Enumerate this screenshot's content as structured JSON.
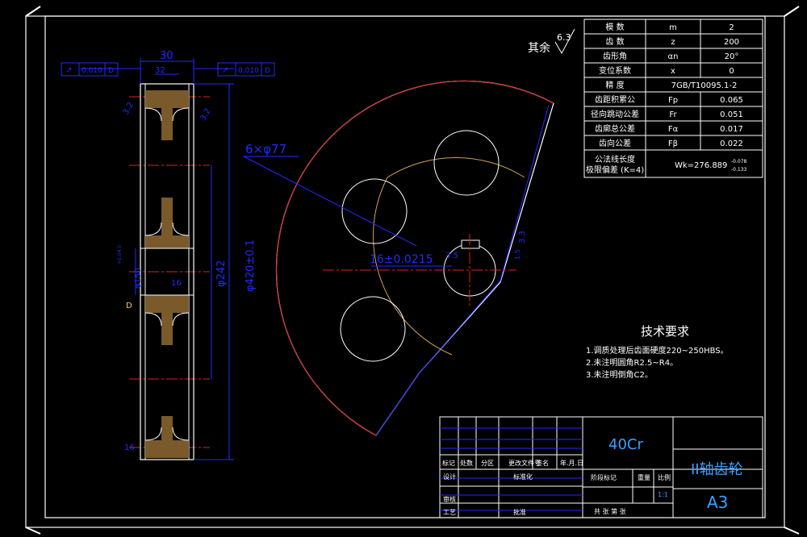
{
  "params": {
    "rows": [
      {
        "name": "模  数",
        "symbol": "m",
        "value": "2"
      },
      {
        "name": "齿  数",
        "symbol": "z",
        "value": "200"
      },
      {
        "name": "齿形角",
        "symbol": "αn",
        "value": "20°"
      },
      {
        "name": "变位系数",
        "symbol": "x",
        "value": "0"
      },
      {
        "name": "精  度",
        "symbol": "",
        "value": "7GB/T10095.1-2"
      },
      {
        "name": "齿距积累公",
        "symbol": "Fp",
        "value": "0.065"
      },
      {
        "name": "径向跳动公差",
        "symbol": "Fr",
        "value": "0.051"
      },
      {
        "name": "齿廓总公差",
        "symbol": "Fα",
        "value": "0.017"
      },
      {
        "name": "齿向公差",
        "symbol": "Fβ",
        "value": "0.022"
      }
    ],
    "last_row": {
      "name1": "公法线长度",
      "name2": "极限偏差 (K=4)",
      "value": "Wk=276.889",
      "upper": "-0.078",
      "lower": "-0.133"
    }
  },
  "side_view": {
    "tolerance_left": {
      "value": "0.010",
      "datum": "D"
    },
    "tolerance_right": {
      "value": "0.010",
      "datum": "D"
    },
    "dim_width": "30",
    "dim_hub": "32",
    "dim_chamfer_left": "3.2",
    "dim_chamfer_right": "3.2",
    "dim_dia_inner": "φ242",
    "dim_dia_outer": "φ420±0.1",
    "dim_bore": "φ150",
    "dim_bore_tol": "+0.04 0",
    "dim_16_mid": "16",
    "dim_16_bottom": "16",
    "datum_label": "D"
  },
  "front_view": {
    "holes_label": "6×φ77",
    "keyway_label": "16±0.0215",
    "keyway_depth": "3.3",
    "keyway_height": "1.5",
    "keyway_side": "3.5",
    "roughness_prefix": "其余",
    "roughness_value": "6.3"
  },
  "tech": {
    "title": "技术要求",
    "items": [
      "1.调质处理后齿面硬度220~250HBS。",
      "2.未注明圆角R2.5~R4。",
      "3.未注明倒角C2。"
    ]
  },
  "title_block": {
    "material": "40Cr",
    "part_name": "II轴齿轮",
    "sheet_size": "A3",
    "labels_row": [
      "标记",
      "处数",
      "分区",
      "更改文件号",
      "签名",
      "年.月.日"
    ],
    "designer": "设计",
    "standardize": "标准化",
    "stage_mark": "阶段标记",
    "weight": "重量",
    "scale": "比例",
    "scale_value": "1:1",
    "review": "审核",
    "craft": "工艺",
    "approve": "批准",
    "sheets": "共   张  第   张"
  },
  "colors": {
    "background": "#000000",
    "line": "#ffffff",
    "dimension": "#1f2cff",
    "center": "#e02020",
    "accent": "#d0a050",
    "text_blue": "#3aa0ff"
  }
}
